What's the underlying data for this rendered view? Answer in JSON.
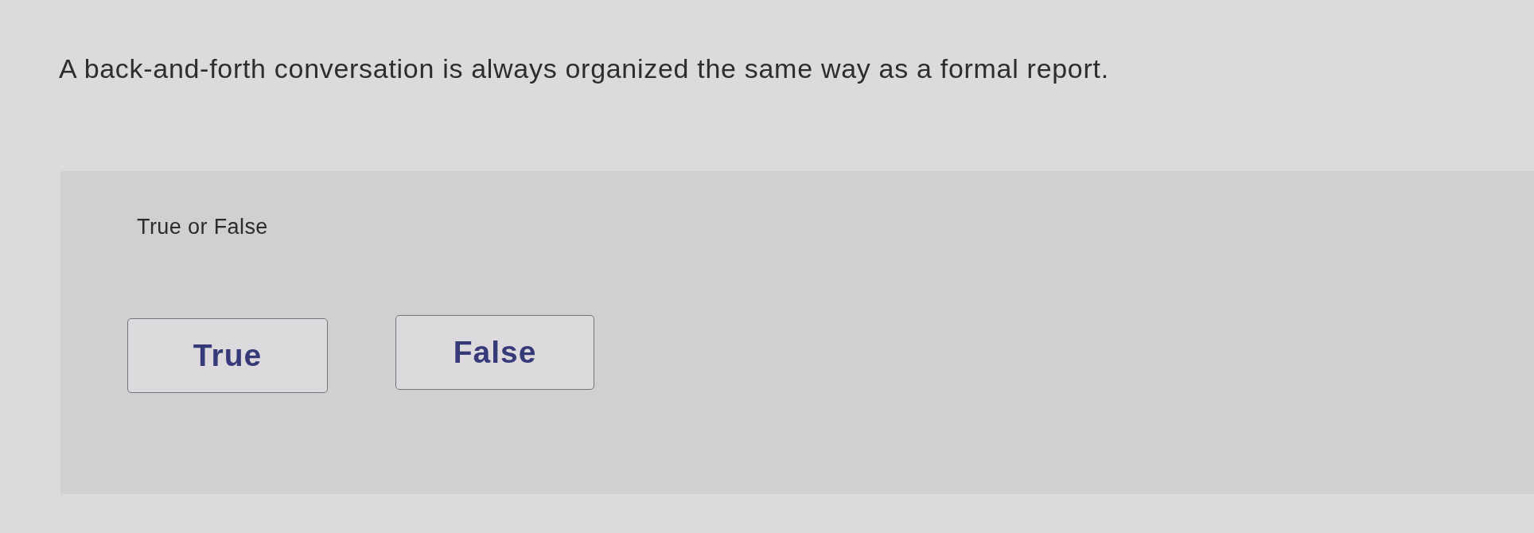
{
  "question": "A back-and-forth conversation is always organized the same way as a formal report.",
  "prompt": "True or False",
  "options": [
    {
      "label": "True"
    },
    {
      "label": "False"
    }
  ]
}
